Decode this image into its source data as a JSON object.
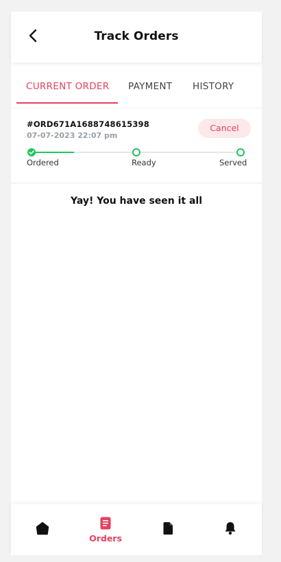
{
  "header": {
    "title": "Track Orders",
    "back_icon": "chevron-left-icon"
  },
  "tabs": [
    {
      "label": "CURRENT ORDER",
      "active": true
    },
    {
      "label": "PAYMENT",
      "active": false
    },
    {
      "label": "HISTORY",
      "active": false
    }
  ],
  "order": {
    "id": "#ORD671A1688748615398",
    "datetime": "07-07-2023 22:07 pm",
    "cancel_label": "Cancel",
    "steps": [
      {
        "label": "Ordered",
        "state": "done"
      },
      {
        "label": "Ready",
        "state": "pending"
      },
      {
        "label": "Served",
        "state": "pending"
      }
    ],
    "progress_fraction": 0.2
  },
  "end_message": "Yay! You have seen it all",
  "bottom_nav": {
    "items": [
      {
        "icon": "home-icon",
        "label": ""
      },
      {
        "icon": "orders-icon",
        "label": "Orders",
        "active": true
      },
      {
        "icon": "document-icon",
        "label": ""
      },
      {
        "icon": "bell-icon",
        "label": ""
      }
    ]
  },
  "colors": {
    "accent": "#e5415f",
    "success": "#22c55e",
    "cancel_bg": "#fde8ea"
  }
}
